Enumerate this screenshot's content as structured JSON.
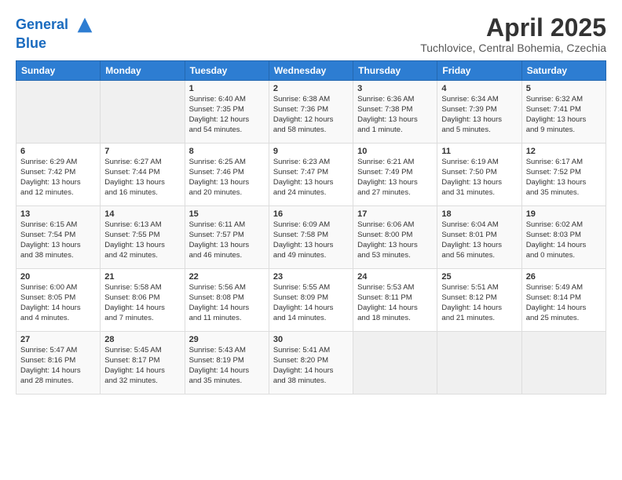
{
  "header": {
    "logo_line1": "General",
    "logo_line2": "Blue",
    "month": "April 2025",
    "location": "Tuchlovice, Central Bohemia, Czechia"
  },
  "days_of_week": [
    "Sunday",
    "Monday",
    "Tuesday",
    "Wednesday",
    "Thursday",
    "Friday",
    "Saturday"
  ],
  "weeks": [
    [
      {
        "day": "",
        "info": ""
      },
      {
        "day": "",
        "info": ""
      },
      {
        "day": "1",
        "info": "Sunrise: 6:40 AM\nSunset: 7:35 PM\nDaylight: 12 hours\nand 54 minutes."
      },
      {
        "day": "2",
        "info": "Sunrise: 6:38 AM\nSunset: 7:36 PM\nDaylight: 12 hours\nand 58 minutes."
      },
      {
        "day": "3",
        "info": "Sunrise: 6:36 AM\nSunset: 7:38 PM\nDaylight: 13 hours\nand 1 minute."
      },
      {
        "day": "4",
        "info": "Sunrise: 6:34 AM\nSunset: 7:39 PM\nDaylight: 13 hours\nand 5 minutes."
      },
      {
        "day": "5",
        "info": "Sunrise: 6:32 AM\nSunset: 7:41 PM\nDaylight: 13 hours\nand 9 minutes."
      }
    ],
    [
      {
        "day": "6",
        "info": "Sunrise: 6:29 AM\nSunset: 7:42 PM\nDaylight: 13 hours\nand 12 minutes."
      },
      {
        "day": "7",
        "info": "Sunrise: 6:27 AM\nSunset: 7:44 PM\nDaylight: 13 hours\nand 16 minutes."
      },
      {
        "day": "8",
        "info": "Sunrise: 6:25 AM\nSunset: 7:46 PM\nDaylight: 13 hours\nand 20 minutes."
      },
      {
        "day": "9",
        "info": "Sunrise: 6:23 AM\nSunset: 7:47 PM\nDaylight: 13 hours\nand 24 minutes."
      },
      {
        "day": "10",
        "info": "Sunrise: 6:21 AM\nSunset: 7:49 PM\nDaylight: 13 hours\nand 27 minutes."
      },
      {
        "day": "11",
        "info": "Sunrise: 6:19 AM\nSunset: 7:50 PM\nDaylight: 13 hours\nand 31 minutes."
      },
      {
        "day": "12",
        "info": "Sunrise: 6:17 AM\nSunset: 7:52 PM\nDaylight: 13 hours\nand 35 minutes."
      }
    ],
    [
      {
        "day": "13",
        "info": "Sunrise: 6:15 AM\nSunset: 7:54 PM\nDaylight: 13 hours\nand 38 minutes."
      },
      {
        "day": "14",
        "info": "Sunrise: 6:13 AM\nSunset: 7:55 PM\nDaylight: 13 hours\nand 42 minutes."
      },
      {
        "day": "15",
        "info": "Sunrise: 6:11 AM\nSunset: 7:57 PM\nDaylight: 13 hours\nand 46 minutes."
      },
      {
        "day": "16",
        "info": "Sunrise: 6:09 AM\nSunset: 7:58 PM\nDaylight: 13 hours\nand 49 minutes."
      },
      {
        "day": "17",
        "info": "Sunrise: 6:06 AM\nSunset: 8:00 PM\nDaylight: 13 hours\nand 53 minutes."
      },
      {
        "day": "18",
        "info": "Sunrise: 6:04 AM\nSunset: 8:01 PM\nDaylight: 13 hours\nand 56 minutes."
      },
      {
        "day": "19",
        "info": "Sunrise: 6:02 AM\nSunset: 8:03 PM\nDaylight: 14 hours\nand 0 minutes."
      }
    ],
    [
      {
        "day": "20",
        "info": "Sunrise: 6:00 AM\nSunset: 8:05 PM\nDaylight: 14 hours\nand 4 minutes."
      },
      {
        "day": "21",
        "info": "Sunrise: 5:58 AM\nSunset: 8:06 PM\nDaylight: 14 hours\nand 7 minutes."
      },
      {
        "day": "22",
        "info": "Sunrise: 5:56 AM\nSunset: 8:08 PM\nDaylight: 14 hours\nand 11 minutes."
      },
      {
        "day": "23",
        "info": "Sunrise: 5:55 AM\nSunset: 8:09 PM\nDaylight: 14 hours\nand 14 minutes."
      },
      {
        "day": "24",
        "info": "Sunrise: 5:53 AM\nSunset: 8:11 PM\nDaylight: 14 hours\nand 18 minutes."
      },
      {
        "day": "25",
        "info": "Sunrise: 5:51 AM\nSunset: 8:12 PM\nDaylight: 14 hours\nand 21 minutes."
      },
      {
        "day": "26",
        "info": "Sunrise: 5:49 AM\nSunset: 8:14 PM\nDaylight: 14 hours\nand 25 minutes."
      }
    ],
    [
      {
        "day": "27",
        "info": "Sunrise: 5:47 AM\nSunset: 8:16 PM\nDaylight: 14 hours\nand 28 minutes."
      },
      {
        "day": "28",
        "info": "Sunrise: 5:45 AM\nSunset: 8:17 PM\nDaylight: 14 hours\nand 32 minutes."
      },
      {
        "day": "29",
        "info": "Sunrise: 5:43 AM\nSunset: 8:19 PM\nDaylight: 14 hours\nand 35 minutes."
      },
      {
        "day": "30",
        "info": "Sunrise: 5:41 AM\nSunset: 8:20 PM\nDaylight: 14 hours\nand 38 minutes."
      },
      {
        "day": "",
        "info": ""
      },
      {
        "day": "",
        "info": ""
      },
      {
        "day": "",
        "info": ""
      }
    ]
  ]
}
